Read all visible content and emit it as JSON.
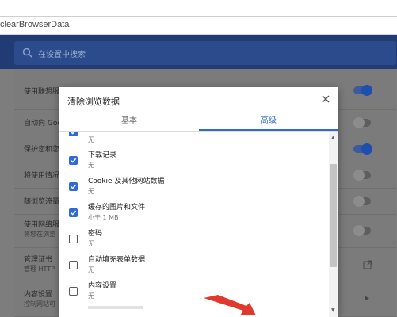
{
  "browser": {
    "url_fragment": "clearBrowserData"
  },
  "settings": {
    "search_placeholder": "在设置中搜索",
    "rows": [
      {
        "title": "使用联想服",
        "subtitle": "",
        "control": "toggle-on"
      },
      {
        "title": "自动向 Goo",
        "subtitle": "",
        "control": "toggle-off"
      },
      {
        "title": "保护您和您",
        "subtitle": "",
        "control": "toggle-on"
      },
      {
        "title": "将使用情况",
        "subtitle": "",
        "control": "toggle-off"
      },
      {
        "title": "随浏览流量",
        "subtitle": "",
        "control": "toggle-off"
      },
      {
        "title": "使用网络服",
        "subtitle": "将您在浏览",
        "control": "toggle-off"
      },
      {
        "title": "管理证书",
        "subtitle": "管理 HTTP",
        "control": "external"
      },
      {
        "title": "内容设置",
        "subtitle": "控制网站可",
        "control": "chevron"
      }
    ]
  },
  "dialog": {
    "title": "清除浏览数据",
    "tabs": {
      "basic": "基本",
      "advanced": "高级",
      "active": "advanced"
    },
    "items": [
      {
        "title": "",
        "subtitle": "无",
        "checked": true
      },
      {
        "title": "下载记录",
        "subtitle": "无",
        "checked": true
      },
      {
        "title": "Cookie 及其他网站数据",
        "subtitle": "无",
        "checked": true
      },
      {
        "title": "缓存的图片和文件",
        "subtitle": "小于 1 MB",
        "checked": true
      },
      {
        "title": "密码",
        "subtitle": "无",
        "checked": false
      },
      {
        "title": "自动填充表单数据",
        "subtitle": "无",
        "checked": false
      },
      {
        "title": "内容设置",
        "subtitle": "无",
        "checked": false
      }
    ]
  },
  "colors": {
    "accent": "#2f6bd6",
    "header": "#213b74",
    "overlay": "#7d7d7d",
    "arrow": "#e03a2f"
  },
  "icons": {
    "close": "close-icon",
    "search": "search-icon",
    "checkbox_checked": "checkbox-checked-icon",
    "external": "external-link-icon",
    "chevron": "chevron-right-icon",
    "annotation": "red-arrow-icon"
  }
}
